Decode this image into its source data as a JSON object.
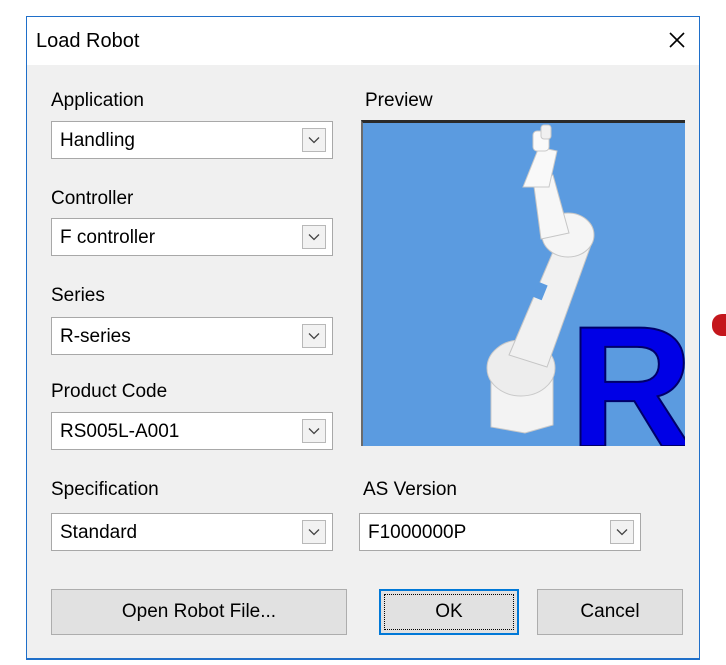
{
  "window": {
    "title": "Load Robot",
    "close_icon": "close-icon"
  },
  "fields": {
    "application": {
      "label": "Application",
      "value": "Handling"
    },
    "controller": {
      "label": "Controller",
      "value": "F controller"
    },
    "series": {
      "label": "Series",
      "value": "R-series"
    },
    "product_code": {
      "label": "Product Code",
      "value": "RS005L-A001"
    },
    "specification": {
      "label": "Specification",
      "value": "Standard"
    },
    "as_version": {
      "label": "AS Version",
      "value": "F1000000P"
    }
  },
  "preview": {
    "label": "Preview",
    "series_letter": "R",
    "background_color": "#5b9be0",
    "letter_color": "#0000e6"
  },
  "buttons": {
    "open_robot_file": "Open Robot File...",
    "ok": "OK",
    "cancel": "Cancel"
  }
}
